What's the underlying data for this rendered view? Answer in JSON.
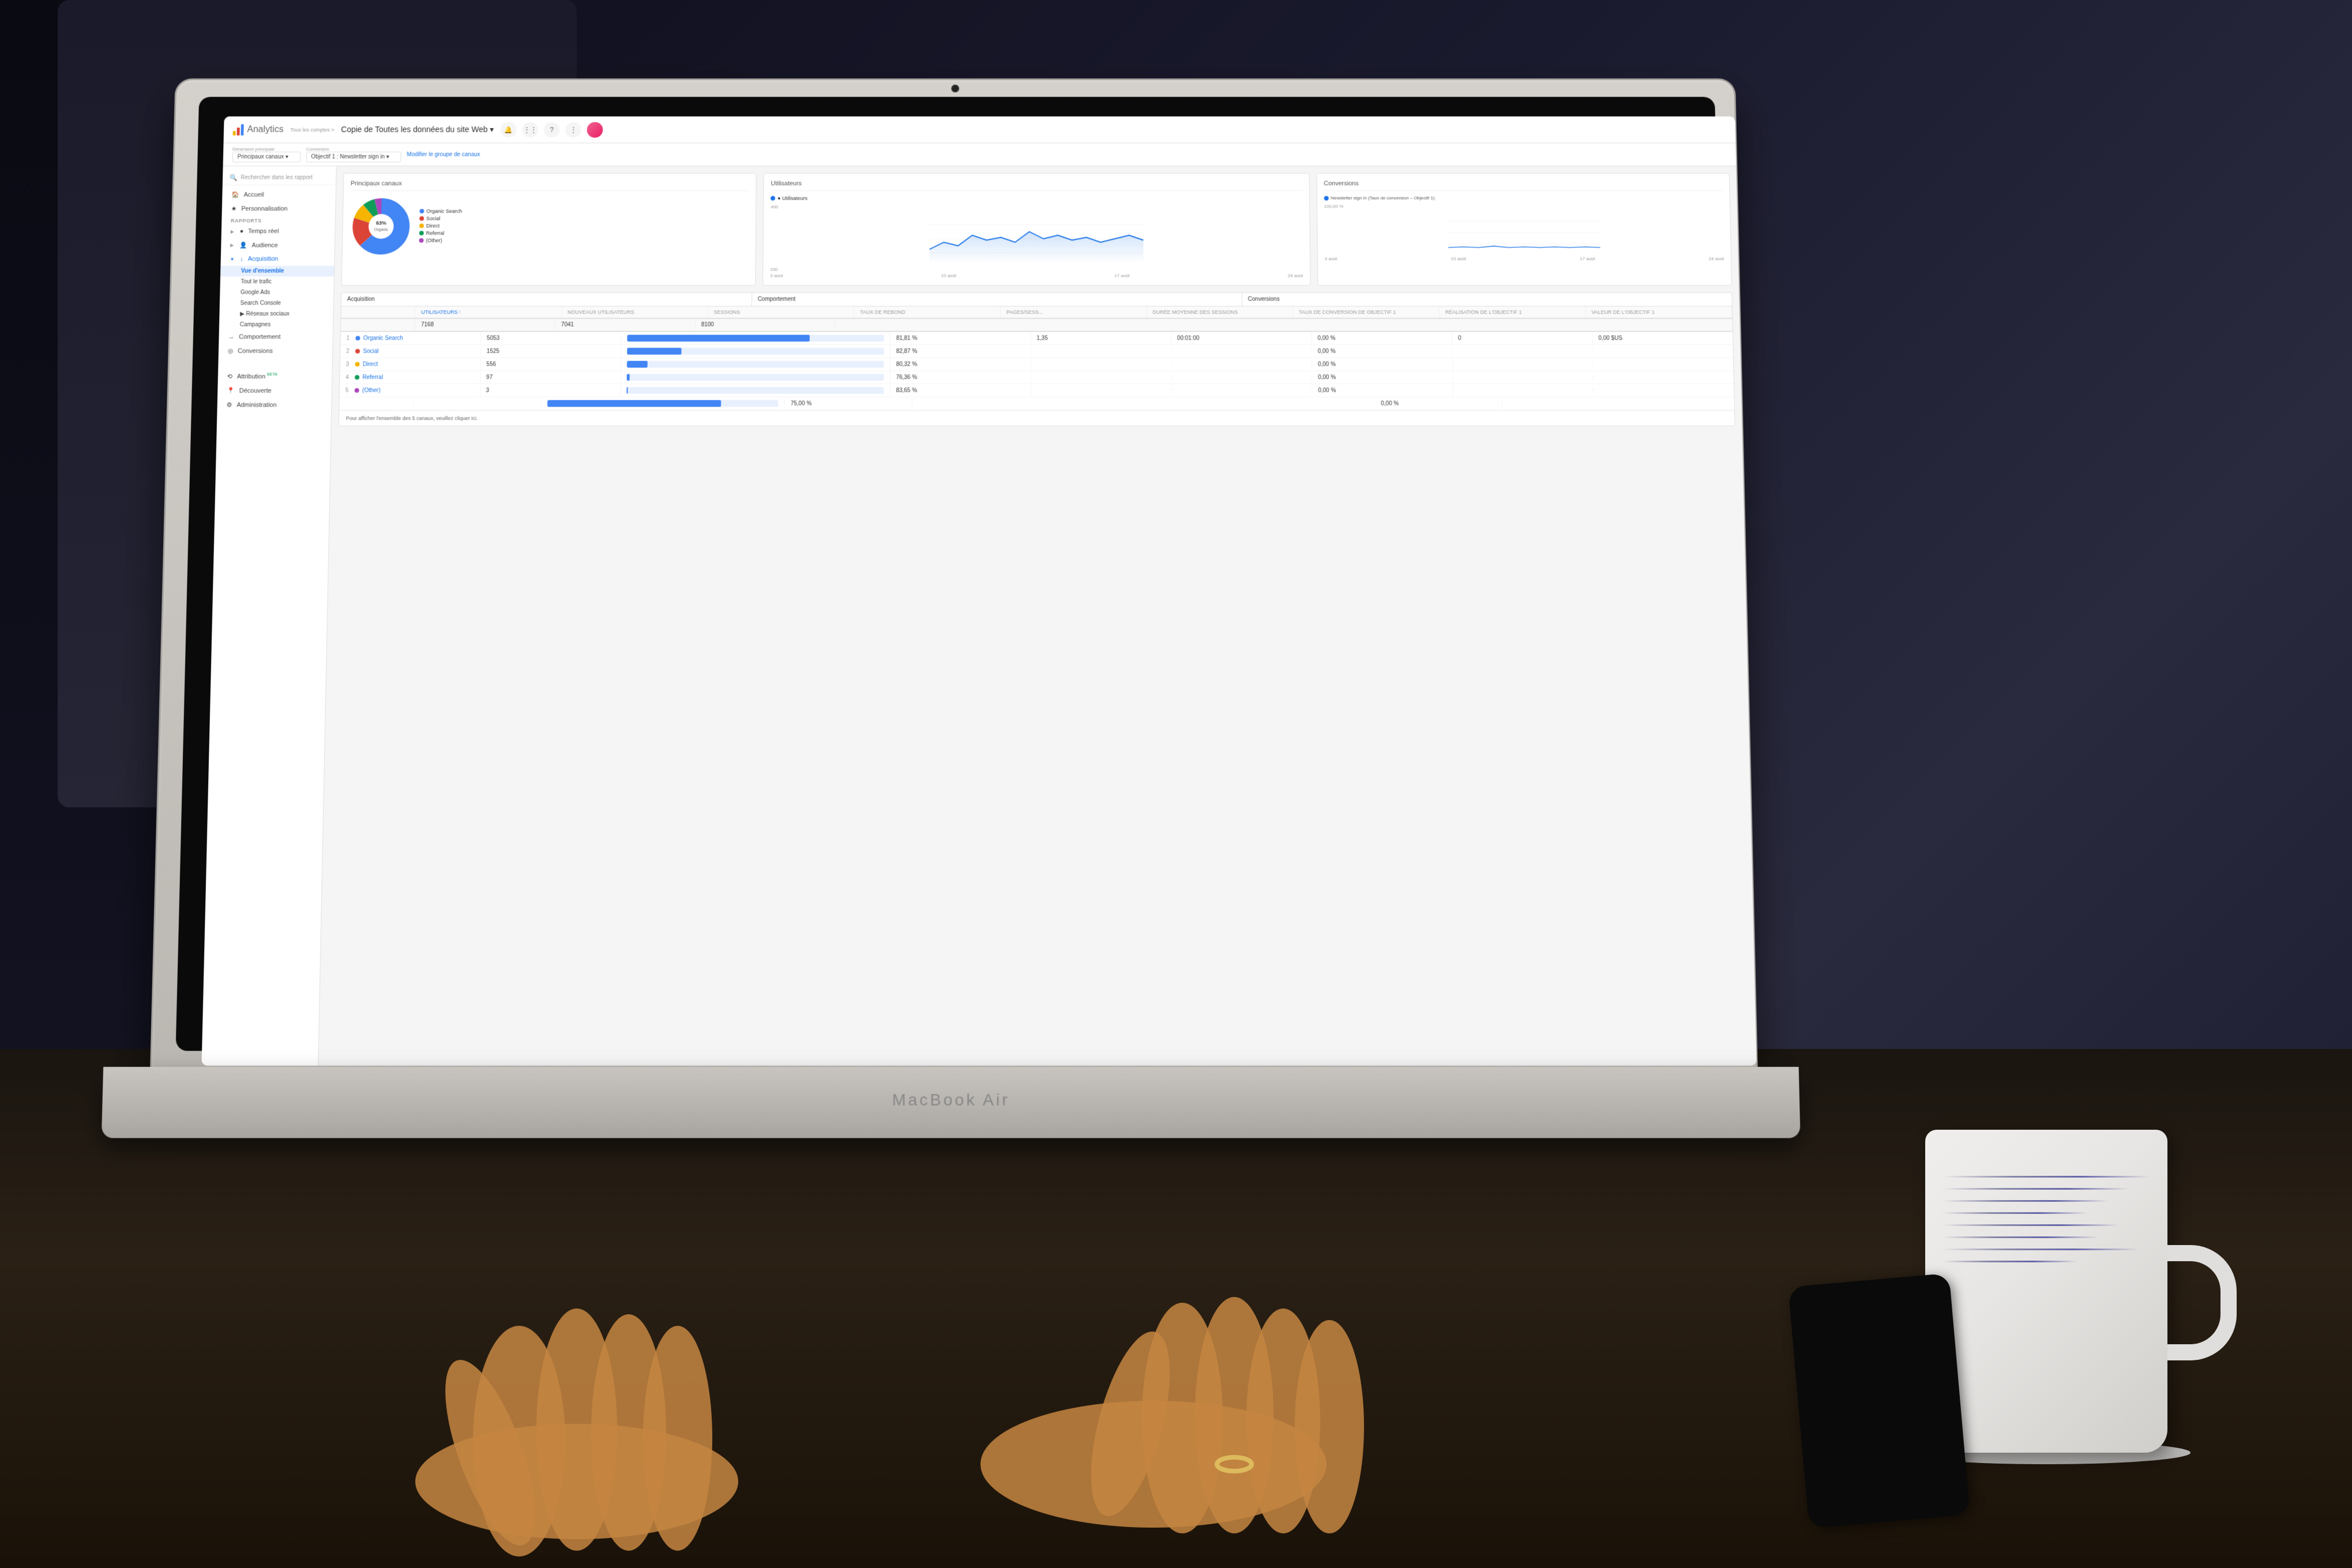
{
  "scene": {
    "laptop_brand": "MacBook Air"
  },
  "ga": {
    "app_title": "Analytics",
    "breadcrumb": "Tous les comptes >",
    "page_title": "Copie de Toutes les données du site Web ▾",
    "topnav_icons": [
      "🔔",
      "⋮⋮",
      "?",
      "⋮"
    ],
    "filter_bar": {
      "dimension_label": "Dimension principale",
      "dimension_value": "Principaux canaux ▾",
      "conversion_label": "Conversion",
      "conversion_value": "Objectif 1 : Newsletter sign in ▾",
      "link_text": "Modifier le groupe de canaux"
    },
    "sidebar": {
      "search_placeholder": "Rechercher dans les rapport",
      "items": [
        {
          "id": "accueil",
          "label": "Accueil",
          "icon": "🏠",
          "level": 1
        },
        {
          "id": "perso",
          "label": "Personnalisation",
          "icon": "★",
          "level": 1
        },
        {
          "id": "rapports_header",
          "label": "RAPPORTS",
          "type": "section"
        },
        {
          "id": "temps_reel",
          "label": "Temps réel",
          "icon": "●",
          "level": 1
        },
        {
          "id": "audience",
          "label": "Audience",
          "icon": "👤",
          "level": 1
        },
        {
          "id": "acquisition",
          "label": "Acquisition",
          "icon": "↓",
          "level": 1,
          "expanded": true
        },
        {
          "id": "vue_ensemble",
          "label": "Vue d'ensemble",
          "level": 2,
          "active": true
        },
        {
          "id": "tout_trafic",
          "label": "Tout le trafic",
          "level": 2
        },
        {
          "id": "google_ads",
          "label": "Google Ads",
          "level": 2
        },
        {
          "id": "search_console",
          "label": "Search Console",
          "level": 2
        },
        {
          "id": "reseaux_sociaux",
          "label": "Réseaux sociaux",
          "level": 2
        },
        {
          "id": "campagnes",
          "label": "Campagnes",
          "level": 2
        },
        {
          "id": "comportement",
          "label": "Comportement",
          "icon": "→",
          "level": 1
        },
        {
          "id": "conversions",
          "label": "Conversions",
          "icon": "◎",
          "level": 1
        },
        {
          "id": "attribution",
          "label": "Attribution BETA",
          "icon": "⟲",
          "level": 1
        },
        {
          "id": "decouverte",
          "label": "Découverte",
          "icon": "📍",
          "level": 1
        },
        {
          "id": "admin",
          "label": "Administration",
          "icon": "⚙",
          "level": 1
        }
      ]
    },
    "charts": {
      "principaux_canaux": {
        "title": "Principaux canaux",
        "legend": [
          {
            "label": "Organic Search",
            "color": "#4285f4"
          },
          {
            "label": "Social",
            "color": "#db4437"
          },
          {
            "label": "Direct",
            "color": "#f4b400"
          },
          {
            "label": "Referral",
            "color": "#0f9d58"
          },
          {
            "label": "(Other)",
            "color": "#ab47bc"
          }
        ],
        "slices": [
          {
            "label": "Organic Search",
            "color": "#4285f4",
            "pct": 63,
            "start": 0,
            "end": 227
          },
          {
            "label": "Social",
            "color": "#db4437",
            "pct": 17,
            "start": 227,
            "end": 288
          },
          {
            "label": "Direct",
            "color": "#f4b400",
            "pct": 9,
            "start": 288,
            "end": 320
          },
          {
            "label": "Referral",
            "color": "#0f9d58",
            "pct": 7,
            "start": 320,
            "end": 345
          },
          {
            "label": "Other",
            "color": "#ab47bc",
            "pct": 4,
            "start": 345,
            "end": 360
          }
        ],
        "inner_label": "63%"
      },
      "utilisateurs": {
        "title": "Utilisateurs",
        "legend_label": "● Utilisateurs",
        "legend_color": "#1a73e8",
        "y_value": "400",
        "y_value2": "200",
        "x_labels": [
          "3 août",
          "10 août",
          "17 août",
          "24 août"
        ]
      },
      "conversions": {
        "title": "Conversions",
        "legend_label": "● Newsletter sign in (Taux de conversion – Objectif 1)",
        "legend_color": "#1a73e8",
        "y_value": "100,00 %",
        "x_labels": [
          "3 août",
          "10 août",
          "17 août",
          "24 août"
        ]
      }
    },
    "acquisition_table": {
      "title": "Acquisition",
      "headers": [
        "Utilisateurs ↑",
        "Nouveaux utilisateurs",
        "Sessions"
      ],
      "comportement_headers": [
        "Taux de rebond",
        "Pages/sess...",
        "Durée moyenne des sessions"
      ],
      "conversions_headers": [
        "Taux de conversion de Objectif 1",
        "Réalisation de l'objectif 1",
        "Valeur de l'objectif 1"
      ],
      "totals": {
        "utilisateurs": "7168",
        "nouveaux": "7041",
        "sessions": "8100"
      },
      "rows": [
        {
          "rank": "1",
          "channel": "Organic Search",
          "color": "#4285f4",
          "utilisateurs": "5053",
          "bar_pct": 71,
          "taux_rebond": "81,81 %",
          "pages": "1,35",
          "duree": "00:01:00",
          "conv_rate": "0,00 %",
          "objectif": "0",
          "valeur": "0,00 $US"
        },
        {
          "rank": "2",
          "channel": "Social",
          "color": "#db4437",
          "utilisateurs": "1525",
          "bar_pct": 21,
          "taux_rebond": "82,87 %",
          "pages": "",
          "duree": "",
          "conv_rate": "0,00 %",
          "objectif": "",
          "valeur": ""
        },
        {
          "rank": "3",
          "channel": "Direct",
          "color": "#f4b400",
          "utilisateurs": "556",
          "bar_pct": 8,
          "taux_rebond": "80,32 %",
          "pages": "",
          "duree": "",
          "conv_rate": "0,00 %",
          "objectif": "",
          "valeur": ""
        },
        {
          "rank": "4",
          "channel": "Referral",
          "color": "#0f9d58",
          "utilisateurs": "97",
          "bar_pct": 1,
          "taux_rebond": "76,36 %",
          "pages": "",
          "duree": "",
          "conv_rate": "0,00 %",
          "objectif": "",
          "valeur": ""
        },
        {
          "rank": "5",
          "channel": "(Other)",
          "color": "#ab47bc",
          "utilisateurs": "3",
          "bar_pct": 0.5,
          "taux_rebond": "83,65 %",
          "pages": "",
          "duree": "",
          "conv_rate": "0,00 %",
          "objectif": "",
          "valeur": ""
        }
      ],
      "footer_text": "Pour afficher l'ensemble des 5 canaux, veuillez cliquer ici."
    }
  }
}
